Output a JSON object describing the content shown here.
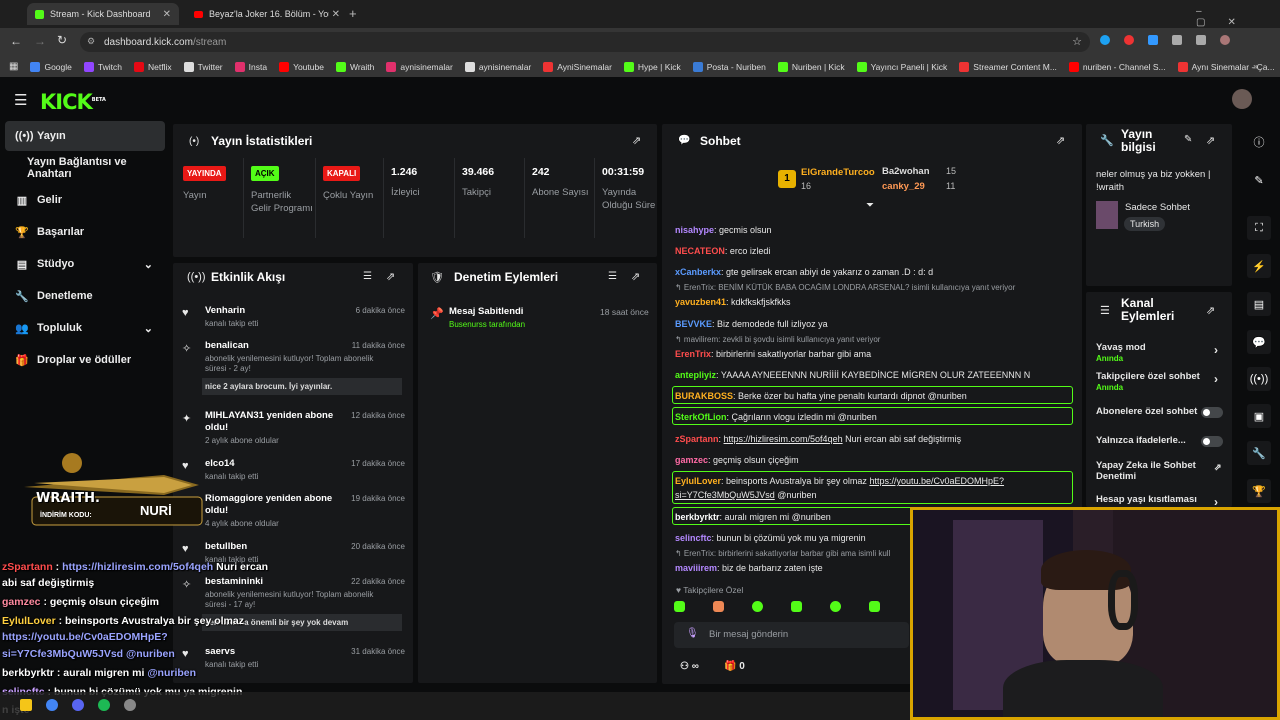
{
  "browser": {
    "tabs": [
      {
        "title": "Stream - Kick Dashboard"
      },
      {
        "title": "Beyaz'la Joker 16. Bölüm - YouT"
      }
    ],
    "url_host": "dashboard.kick.com",
    "url_path": "/stream",
    "bookmarks": [
      "Google",
      "Twitch",
      "Netflix",
      "Twitter",
      "Insta",
      "Youtube",
      "Wraith",
      "aynisinemalar",
      "aynisinemalar",
      "AyniSinemalar",
      "Hype | Kick",
      "Posta - Nuriben",
      "Nuriben | Kick",
      "Yayıncı Paneli | Kick",
      "Streamer Content M...",
      "nuriben - Channel S...",
      "Aynı Sinemalar - Ça..."
    ]
  },
  "brand": {
    "logo": "KICK",
    "beta": "BETA"
  },
  "sidebar": {
    "items": [
      "Yayın",
      "Yayın Bağlantısı ve Anahtarı",
      "Gelir",
      "Başarılar",
      "Stüdyo",
      "Denetleme",
      "Topluluk",
      "Droplar ve ödüller"
    ]
  },
  "stats_panel": {
    "title": "Yayın İstatistikleri",
    "items": [
      {
        "value": "YAYINDA",
        "label": "Yayın"
      },
      {
        "value": "AÇIK",
        "label": "Partnerlik Gelir Programı"
      },
      {
        "value": "KAPALI",
        "label": "Çoklu Yayın"
      },
      {
        "value": "1.246",
        "label": "İzleyici"
      },
      {
        "value": "39.466",
        "label": "Takipçi"
      },
      {
        "value": "242",
        "label": "Abone Sayısı"
      },
      {
        "value": "00:31:59",
        "label": "Yayında Olduğu Süre"
      }
    ]
  },
  "activity_panel": {
    "title": "Etkinlik Akışı",
    "items": [
      {
        "name": "Venharin",
        "time": "6 dakika önce",
        "sub": "kanalı takip etti"
      },
      {
        "name": "benalican",
        "time": "11 dakika önce",
        "sub": "abonelik yenilemesini kutluyor! Toplam abonelik süresi - 2 ay!",
        "msg": "nice 2 aylara brocum. İyi yayınlar."
      },
      {
        "name": "MIHLAYAN31 yeniden abone oldu!",
        "time": "12 dakika önce",
        "sub": "2 aylık abone oldular"
      },
      {
        "name": "elco14",
        "time": "17 dakika önce",
        "sub": "kanalı takip etti"
      },
      {
        "name": "Riomaggiore yeniden abone oldu!",
        "time": "19 dakika önce",
        "sub": "4 aylık abone oldular"
      },
      {
        "name": "betullben",
        "time": "20 dakika önce",
        "sub": "kanalı takip etti"
      },
      {
        "name": "bestamininki",
        "time": "22 dakika önce",
        "sub": "abonelik yenilemesini kutluyor! Toplam abonelik süresi - 17 ay!",
        "msg": "sen takılma önemli bir şey yok devam"
      },
      {
        "name": "saervs",
        "time": "31 dakika önce",
        "sub": "kanalı takip etti"
      }
    ]
  },
  "moderation_panel": {
    "title": "Denetim Eylemleri",
    "items": [
      {
        "name": "Mesaj Sabitlendi",
        "by": "Busenurss tarafından",
        "time": "18 saat önce"
      }
    ]
  },
  "chat_panel": {
    "title": "Sohbet",
    "top_gifters": [
      {
        "rank": "1",
        "name": "ElGrandeTurcoo",
        "count": "16"
      },
      {
        "name": "Ba2wohan",
        "count": "15"
      },
      {
        "name": "canky_29",
        "count": "11"
      }
    ],
    "messages": [
      {
        "user": "nisahype",
        "text": "gecmis olsun",
        "color": "#b388ff"
      },
      {
        "user": "NECATEON",
        "text": "erco izledi",
        "color": "#ff4d4d"
      },
      {
        "user": "xCanberkx",
        "text": "gte gelirsek ercan abiyi de yakarız o zaman .D : d: d",
        "color": "#5b9bff"
      },
      {
        "reply": "↰ ErenTrix: BENİM KÜTÜK BABA OCAĞIM LONDRA ARSENAL? isimli kullanıcıya yanıt veriyor",
        "user": "yavuzben41",
        "text": "kdkfkskfjskfkks",
        "color": "#ffb020"
      },
      {
        "user": "BEVVKE",
        "text": "Biz demodede full izliyoz ya",
        "color": "#5b9bff"
      },
      {
        "reply": "↰ mavilirem: zevkli bi şovdu isimli kullanıcıya yanıt veriyor",
        "user": "ErenTrix",
        "text": "birbirlerini sakatlıyorlar barbar gibi ama",
        "color": "#ff4d4d"
      },
      {
        "user": "antepliyiz",
        "text": "YAAAA AYNEEENNN NURİİİİ KAYBEDİNCE MİGREN OLUR ZATEEENNN N",
        "color": "#53fc18"
      },
      {
        "user": "BURAKBOSS",
        "text": "Berke özer bu hafta yine penaltı kurtardı dipnot @nuriben",
        "color": "#ffb020",
        "hl": true
      },
      {
        "user": "SterkOfLion",
        "text": "Çağrıların vlogu izledin mi @nuriben",
        "color": "#53fc18",
        "hl": true
      },
      {
        "user": "zSpartann",
        "text": "https://hizliresim.com/5of4qeh",
        "tail": " Nuri ercan abi saf değiştirmiş",
        "color": "#ff4d4d"
      },
      {
        "user": "gamzec",
        "text": "geçmiş olsun çiçeğim",
        "color": "#ff6ba6"
      },
      {
        "user": "EylulLover",
        "text": "beinsports Avustralya bir şey olmaz ",
        "link": "https://youtu.be/Cv0aEDOMHpE?si=Y7Cfe3MbQuW5JVsd",
        "tail": " @nuriben",
        "color": "#ffb020",
        "hl": true
      },
      {
        "user": "berkbyrktr",
        "text": "auralı migren mi @nuriben",
        "color": "#ffffff",
        "hl": true
      },
      {
        "user": "selincftc",
        "text": "bunun bi çözümü yok mu ya migrenin",
        "color": "#b388ff"
      },
      {
        "reply": "↰ ErenTrix: birbirlerini sakatlıyorlar barbar gibi ama isimli kull",
        "user": "maviiirem",
        "text": "biz de barbarız zaten işte",
        "color": "#b388ff"
      }
    ],
    "followers_only": "Takipçilere Özel",
    "input_placeholder": "Bir mesaj gönderin",
    "viewers_inf": "∞",
    "count": "0"
  },
  "stream_info": {
    "title": "Yayın bilgisi",
    "text": "neler olmuş ya biz yokken | !wraith",
    "category": "Sadece Sohbet",
    "language": "Turkish"
  },
  "channel_actions": {
    "title": "Kanal Eylemleri",
    "items": [
      {
        "label": "Yavaş mod",
        "sub": "Anında"
      },
      {
        "label": "Takipçilere özel sohbet",
        "sub": "Anında"
      },
      {
        "label": "Abonelere özel sohbet"
      },
      {
        "label": "Yalnızca ifadelerle..."
      },
      {
        "label": "Yapay Zeka ile Sohbet Denetimi"
      },
      {
        "label": "Hesap yaşı kısıtlaması"
      }
    ]
  },
  "overlay": {
    "promo_logo": "WRAITH.",
    "promo_code_label": "İNDİRİM KODU:",
    "promo_code": "NURİ",
    "chat": [
      {
        "user": "zSpartann",
        "text": " : ",
        "link": "https://hizliresim.com/5of4qeh",
        "tail": " Nuri ercan"
      },
      {
        "text": "abi saf değiştirmiş"
      },
      {
        "user": "gamzec",
        "text": " : geçmiş olsun çiçeğim"
      },
      {
        "user": "EylulLover",
        "text": " : beinsports Avustralya bir şey olmaz"
      },
      {
        "link": "https://youtu.be/Cv0aEDOMHpE?"
      },
      {
        "link": "si=Y7Cfe3MbQuW5JVsd",
        "tail": " @nuriben"
      },
      {
        "user": "berkbyrktr",
        "text": " : auralı migren mi ",
        "tail2": "@nuriben"
      },
      {
        "user": "selincftc",
        "text": " : bunun bi çözümü yok mu ya migrenin"
      },
      {
        "text": "n işte"
      }
    ]
  },
  "colors": {
    "accent": "#53fc18",
    "bg": "#0b0c0d",
    "panel": "#17181a",
    "red": "#e91916"
  }
}
